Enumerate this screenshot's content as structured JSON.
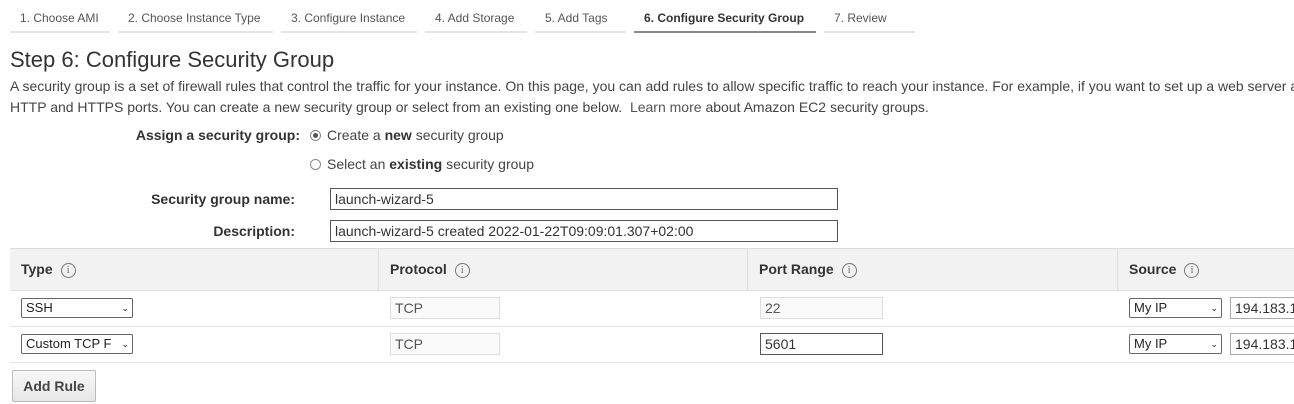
{
  "wizard_tabs": [
    {
      "label": "1. Choose AMI"
    },
    {
      "label": "2. Choose Instance Type"
    },
    {
      "label": "3. Configure Instance"
    },
    {
      "label": "4. Add Storage"
    },
    {
      "label": "5. Add Tags"
    },
    {
      "label": "6. Configure Security Group"
    },
    {
      "label": "7. Review"
    }
  ],
  "page": {
    "title": "Step 6: Configure Security Group",
    "description_1": "A security group is a set of firewall rules that control the traffic for your instance. On this page, you can add rules to allow specific traffic to reach your instance. For example, if you want to set up a web server a",
    "description_2": "HTTP and HTTPS ports. You can create a new security group or select from an existing one below.",
    "learn_more": "Learn more",
    "description_3": "about Amazon EC2 security groups."
  },
  "assign": {
    "label": "Assign a security group:",
    "option_new_pre": "Create a",
    "option_new_bold": "new",
    "option_new_post": "security group",
    "option_existing_pre": "Select an",
    "option_existing_bold": "existing",
    "option_existing_post": "security group",
    "selected": "new"
  },
  "form": {
    "name_label": "Security group name:",
    "name_value": "launch-wizard-5",
    "description_label": "Description:",
    "description_value": "launch-wizard-5 created 2022-01-22T09:09:01.307+02:00"
  },
  "rules_table": {
    "headers": {
      "type": "Type",
      "protocol": "Protocol",
      "port_range": "Port Range",
      "source": "Source"
    },
    "info_icon": "i",
    "select_chevron": "⌄",
    "rows": [
      {
        "type": "SSH",
        "protocol": "TCP",
        "port_range": "22",
        "source": "My IP",
        "source_ip": "194.183.1"
      },
      {
        "type": "Custom TCP F",
        "protocol": "TCP",
        "port_range": "5601",
        "source": "My IP",
        "source_ip": "194.183.1"
      }
    ]
  },
  "buttons": {
    "add_rule": "Add Rule"
  },
  "icons": {
    "info": "info-icon",
    "select_arrow": "chevron-down-icon",
    "radio": "radio-button"
  }
}
